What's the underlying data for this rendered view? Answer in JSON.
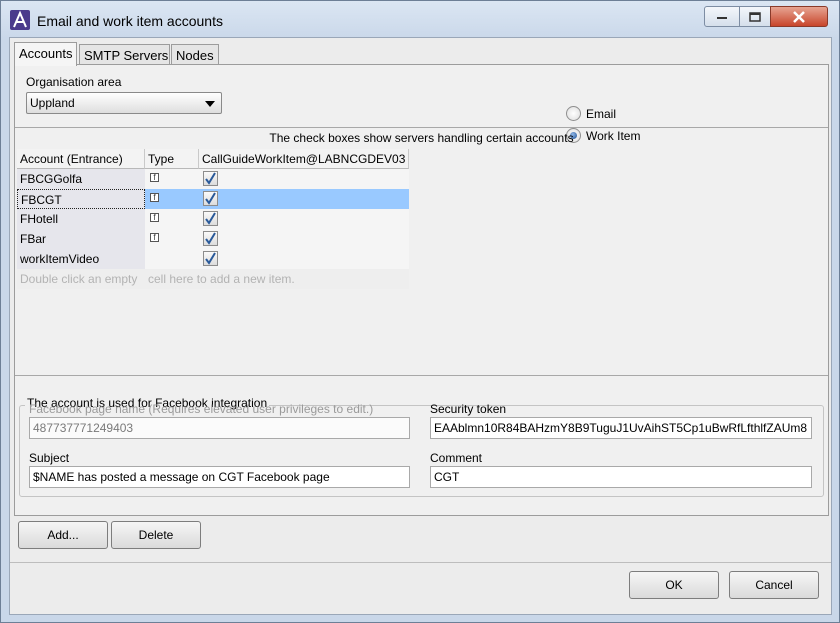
{
  "window": {
    "title": "Email and work item accounts"
  },
  "tabs": [
    {
      "label": "Accounts",
      "active": true
    },
    {
      "label": "SMTP Servers",
      "active": false
    },
    {
      "label": "Nodes",
      "active": false
    }
  ],
  "org_area": {
    "label": "Organisation area",
    "value": "Uppland"
  },
  "mode": {
    "options": [
      {
        "label": "Email",
        "checked": false
      },
      {
        "label": "Work Item",
        "checked": true
      }
    ]
  },
  "table": {
    "caption": "The check boxes show servers handling certain accounts",
    "columns": [
      "Account (Entrance)",
      "Type",
      "CallGuideWorkItem@LABNCGDEV03"
    ],
    "rows": [
      {
        "account": "FBCGGolfa",
        "type_icon": "facebook-icon",
        "checked": true
      },
      {
        "account": "FBCGT",
        "type_icon": "facebook-icon",
        "checked": true,
        "selected": true
      },
      {
        "account": "FHotell",
        "type_icon": "facebook-icon",
        "checked": true
      },
      {
        "account": "FBar",
        "type_icon": "facebook-icon",
        "checked": true
      },
      {
        "account": "workItemVideo",
        "type_icon": "",
        "checked": true
      }
    ],
    "empty_hint": {
      "part1": "Double click an empty",
      "part2": "cell here to add a new item."
    }
  },
  "details": {
    "group_title": "The account is used for Facebook integration",
    "fb_page_label": "Facebook page name (Requires elevated user privileges to edit.)",
    "fb_page_value": "487737771249403",
    "token_label": "Security token",
    "token_value": "EAAblmn10R84BAHzmY8B9TuguJ1UvAihST5Cp1uBwRfLfthlfZAUm8",
    "subject_label": "Subject",
    "subject_value": "$NAME has posted a message on CGT Facebook page",
    "comment_label": "Comment",
    "comment_value": "CGT"
  },
  "buttons": {
    "add": "Add...",
    "delete": "Delete",
    "ok": "OK",
    "cancel": "Cancel"
  },
  "colors": {
    "selection": "#99c9ff",
    "check": "#2a5a9a"
  }
}
